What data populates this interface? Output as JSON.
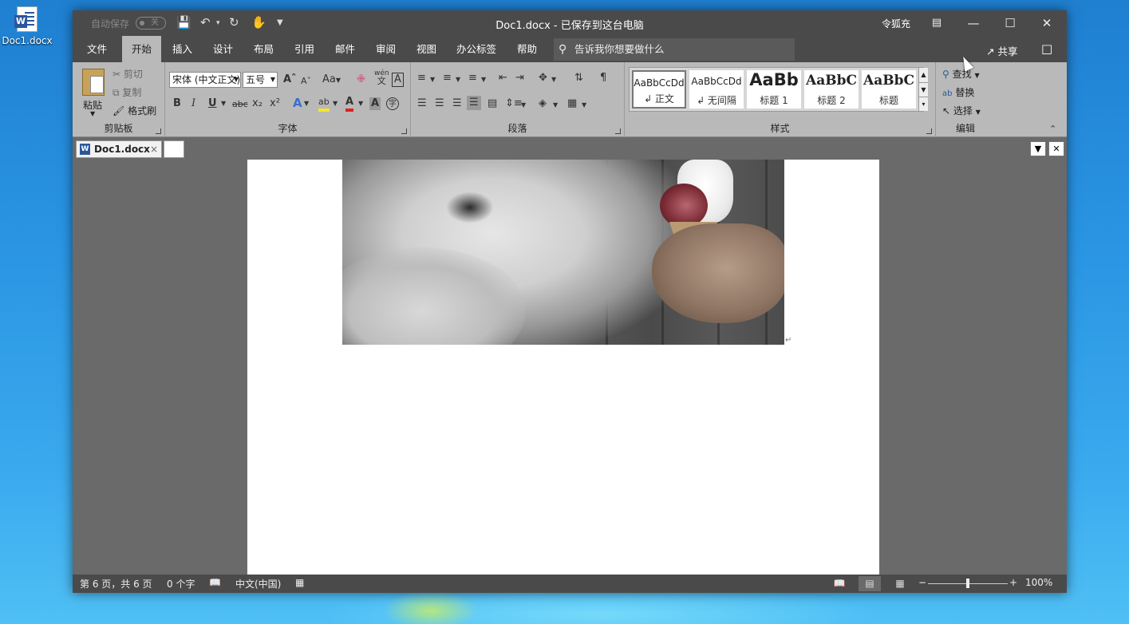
{
  "desktop": {
    "icon_label": "Doc1.docx",
    "icon_glyph": "W"
  },
  "titlebar": {
    "autosave_label": "自动保存",
    "autosave_state": "关",
    "title": "Doc1.docx  -  已保存到这台电脑",
    "user": "令狐充",
    "icons": [
      "save-icon",
      "undo-icon",
      "redo-icon",
      "touch-mode-icon",
      "customize-icon",
      "ribbon-display-icon",
      "minimize-icon",
      "maximize-icon",
      "close-icon"
    ]
  },
  "tabs": [
    {
      "label": "文件"
    },
    {
      "label": "开始"
    },
    {
      "label": "插入"
    },
    {
      "label": "设计"
    },
    {
      "label": "布局"
    },
    {
      "label": "引用"
    },
    {
      "label": "邮件"
    },
    {
      "label": "审阅"
    },
    {
      "label": "视图"
    },
    {
      "label": "办公标签"
    },
    {
      "label": "帮助"
    }
  ],
  "tellme": {
    "placeholder": "告诉我你想要做什么"
  },
  "share": {
    "label": "共享"
  },
  "ribbon": {
    "clipboard": {
      "label": "剪贴板",
      "paste": "粘贴",
      "cut": "剪切",
      "copy": "复制",
      "format_painter": "格式刷"
    },
    "font": {
      "label": "字体",
      "font_name": "宋体 (中文正文)",
      "font_size": "五号",
      "change_case": "Aa",
      "phonetic_top": "wén",
      "phonetic_bottom": "文",
      "glyph_bold": "B",
      "glyph_italic": "I",
      "glyph_underline": "U",
      "glyph_strike": "abc",
      "glyph_sub": "x₂",
      "glyph_sup": "x²",
      "glyph_effects": "A",
      "glyph_highlight": "ab",
      "glyph_fontcolor": "A",
      "glyph_shading": "A",
      "glyph_enclosed": "字"
    },
    "paragraph": {
      "label": "段落"
    },
    "styles": {
      "label": "样式",
      "items": [
        {
          "sample": "AaBbCcDd",
          "name": "↲ 正文"
        },
        {
          "sample": "AaBbCcDd",
          "name": "↲ 无间隔"
        },
        {
          "sample": "AaBb",
          "name": "标题 1"
        },
        {
          "sample": "AaBbC",
          "name": "标题 2"
        },
        {
          "sample": "AaBbC",
          "name": "标题"
        }
      ]
    },
    "editing": {
      "label": "编辑",
      "find": "查找",
      "replace": "替换",
      "select": "选择"
    }
  },
  "doc_tabs": {
    "active": "Doc1.docx",
    "active_icon": "W"
  },
  "document": {
    "paragraph_mark": "↵"
  },
  "statusbar": {
    "page": "第 6 页，共 6 页",
    "words": "0 个字",
    "language": "中文(中国)",
    "zoom": "100%",
    "zoom_fraction": 0.5
  },
  "colors": {
    "titlebar": "#4a4a4a",
    "ribbon": "#b9b9b9",
    "canvas": "#6a6a6a",
    "word_blue": "#2b579a"
  }
}
